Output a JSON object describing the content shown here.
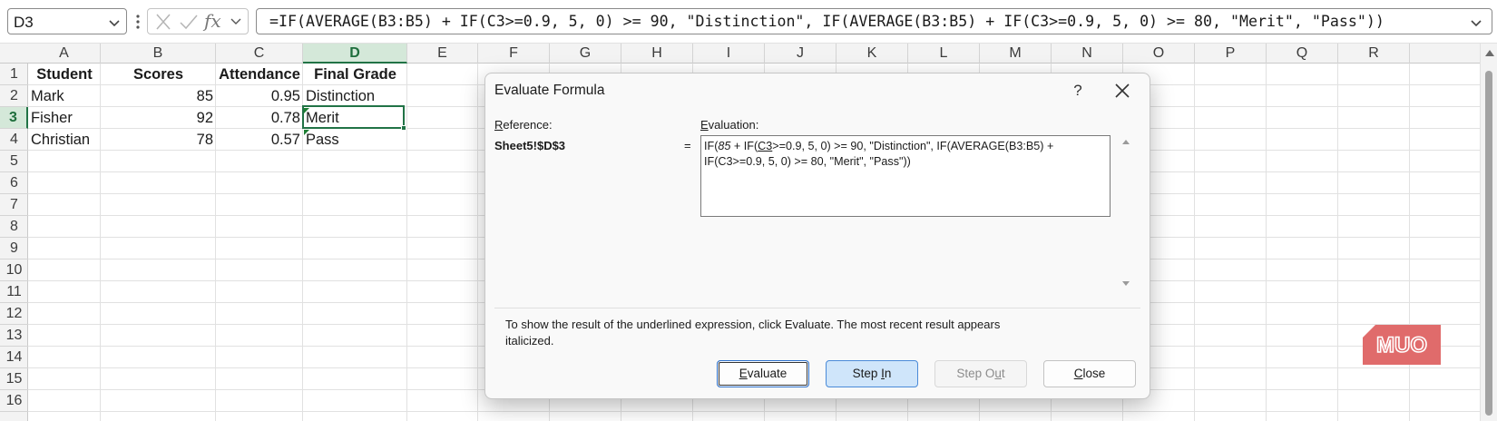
{
  "formula_bar": {
    "name_box": "D3",
    "formula": "=IF(AVERAGE(B3:B5) + IF(C3>=0.9, 5, 0) >= 90, \"Distinction\", IF(AVERAGE(B3:B5) + IF(C3>=0.9, 5, 0) >= 80, \"Merit\", \"Pass\"))",
    "fx_label": "fx"
  },
  "columns": [
    "A",
    "B",
    "C",
    "D",
    "E",
    "F",
    "G",
    "H",
    "I",
    "J",
    "K",
    "L",
    "M",
    "N",
    "O",
    "P",
    "Q",
    "R"
  ],
  "rows": [
    "1",
    "2",
    "3",
    "4",
    "5",
    "6",
    "7",
    "8",
    "9",
    "10",
    "11",
    "12",
    "13",
    "14",
    "15",
    "16"
  ],
  "table": {
    "headers": [
      "Student",
      "Scores",
      "Attendance",
      "Final Grade"
    ],
    "data": [
      [
        "Mark",
        "85",
        "0.95",
        "Distinction"
      ],
      [
        "Fisher",
        "92",
        "0.78",
        "Merit"
      ],
      [
        "Christian",
        "78",
        "0.57",
        "Pass"
      ]
    ]
  },
  "selected_cell": "D3",
  "colors": {
    "excel_green": "#217346",
    "selected_header_bg": "#d4e8d9",
    "accent_blue": "#2a6fcb",
    "muo_logo": "#e06b6b"
  },
  "dialog": {
    "title": "Evaluate Formula",
    "help": "?",
    "reference_label_first": "R",
    "reference_label_rest": "eference:",
    "reference_value": "Sheet5!$D$3",
    "equals": "=",
    "evaluation_label_first": "E",
    "evaluation_label_rest": "valuation:",
    "evaluation": {
      "part1": "IF(",
      "italic": "85",
      "part2": " + IF(",
      "underlined": "C3",
      "part3": ">=0.9, 5, 0) >= 90, \"Distinction\", IF(AVERAGE(B3:B5) + IF(C3>=0.9, 5, 0) >= 80, \"Merit\", \"Pass\"))"
    },
    "hint": "To show the result of the underlined expression, click Evaluate.  The most recent result appears italicized.",
    "buttons": {
      "evaluate_first": "E",
      "evaluate_rest": "valuate",
      "step_in_pre": "Step ",
      "step_in_ul": "I",
      "step_in_rest": "n",
      "step_out_pre": "Step O",
      "step_out_ul": "u",
      "step_out_rest": "t",
      "close_first": "C",
      "close_rest": "lose"
    }
  },
  "logo": "MUO"
}
